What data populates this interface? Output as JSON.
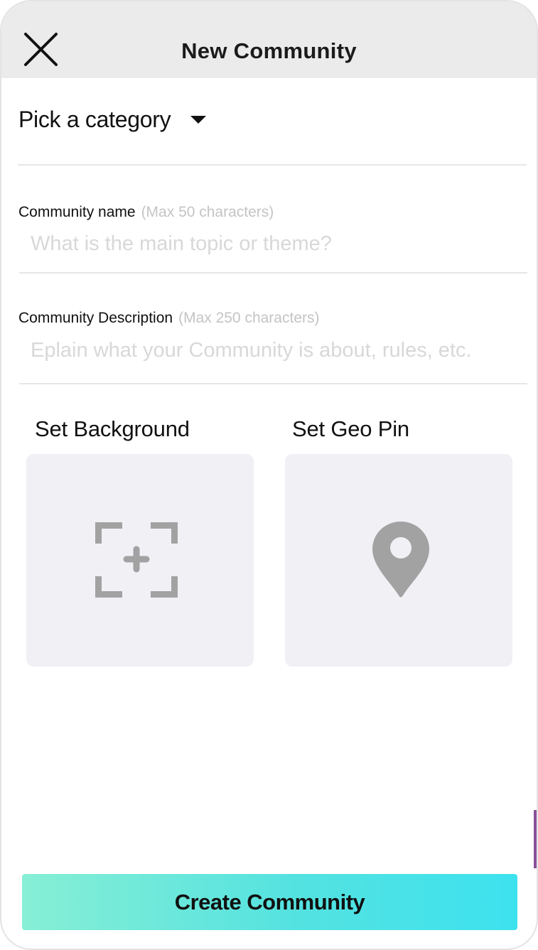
{
  "header": {
    "title": "New Community",
    "close_icon": "close-icon"
  },
  "category": {
    "label": "Pick a category",
    "caret_icon": "caret-down-icon"
  },
  "name_field": {
    "label": "Community name",
    "hint": "(Max 50 characters)",
    "placeholder": "What is the main topic or theme?",
    "value": ""
  },
  "description_field": {
    "label": "Community Description",
    "hint": "(Max 250 characters)",
    "placeholder": "Eplain what your Community is about, rules, etc.",
    "value": ""
  },
  "background": {
    "title": "Set Background",
    "icon": "add-photo-frame-icon"
  },
  "geo_pin": {
    "title": "Set Geo Pin",
    "icon": "location-pin-icon"
  },
  "create_button": {
    "label": "Create Community"
  },
  "colors": {
    "topbar": "#ebebeb",
    "tile": "#f0f0f5",
    "icon_gray": "#a2a2a2",
    "button_gradient_start": "#87efd5",
    "button_gradient_end": "#3de2ef"
  }
}
